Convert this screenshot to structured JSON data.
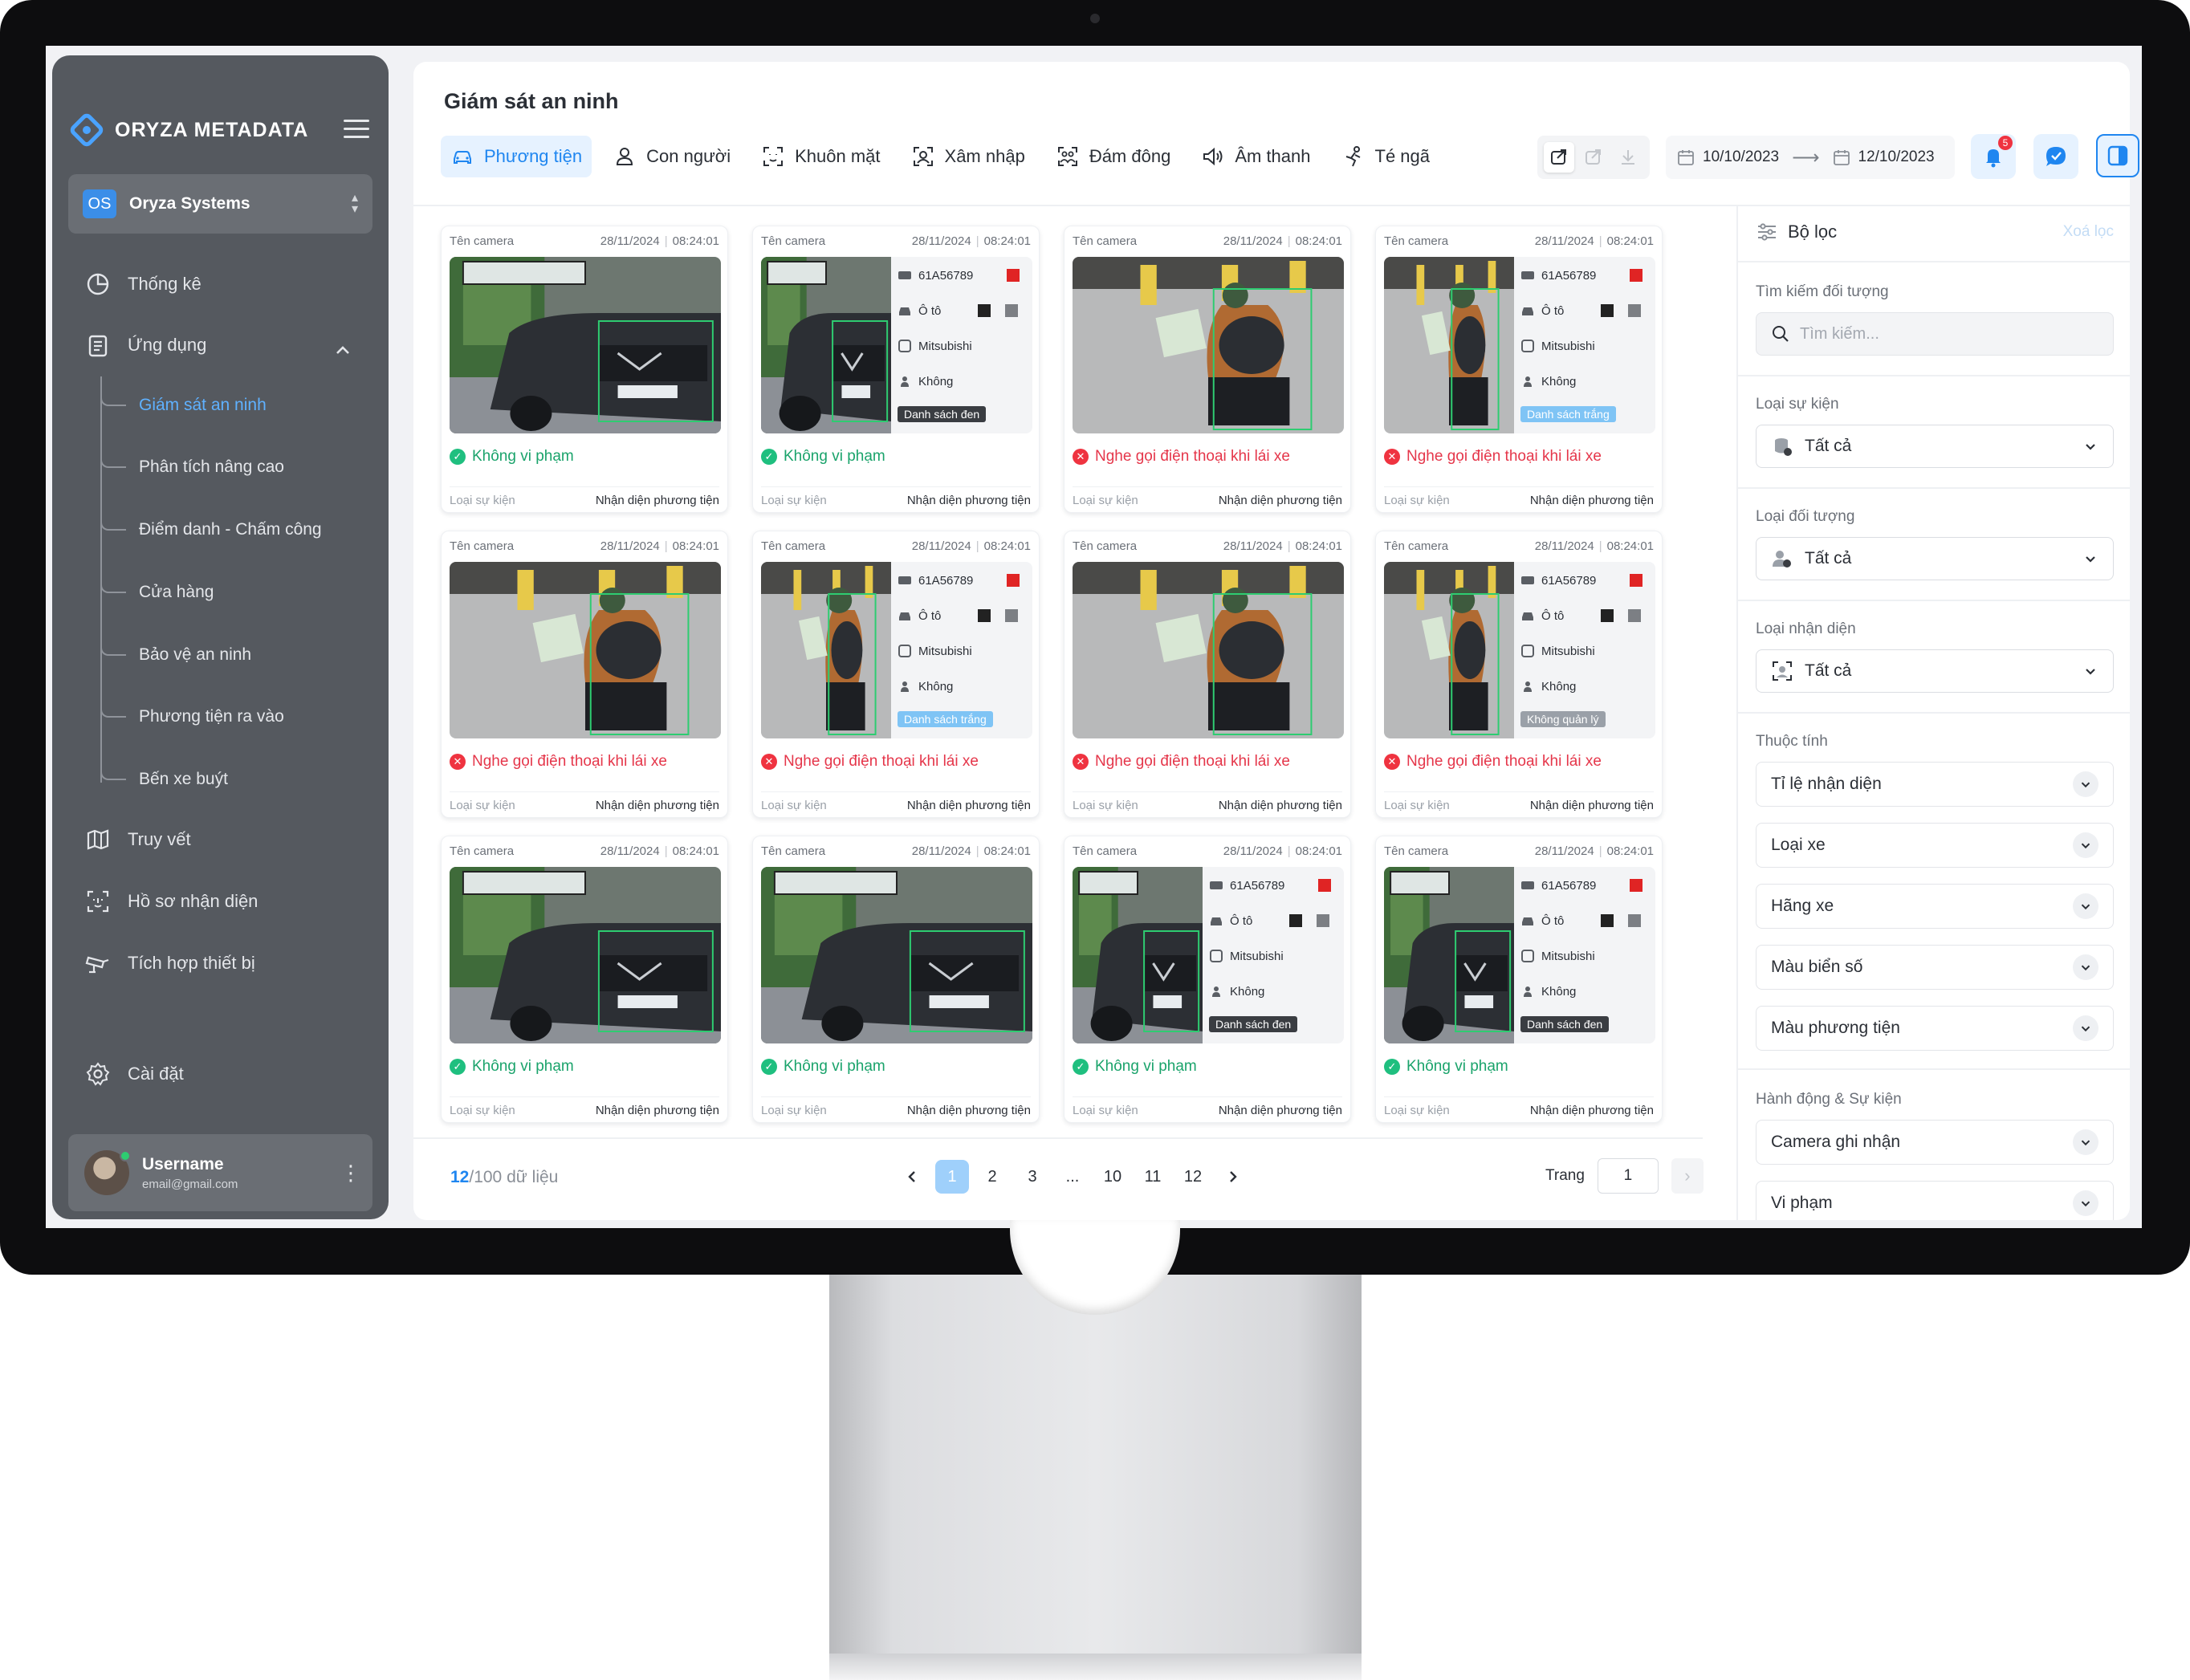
{
  "brand": {
    "name": "ORYZA METADATA"
  },
  "org": {
    "badge": "OS",
    "name": "Oryza Systems"
  },
  "nav": {
    "thong_ke": "Thống kê",
    "ung_dung": "Ứng dụng",
    "sub": [
      "Giám sát an ninh",
      "Phân tích nâng cao",
      "Điểm danh - Chấm công",
      "Cửa hàng",
      "Bảo vệ an ninh",
      "Phương tiện ra vào",
      "Bến xe buýt"
    ],
    "truy_vet": "Truy vết",
    "ho_so": "Hồ sơ nhận diện",
    "tich_hop": "Tích hợp thiết bị",
    "cai_dat": "Cài đặt"
  },
  "user": {
    "name": "Username",
    "email": "email@gmail.com"
  },
  "page": {
    "title": "Giám sát an ninh"
  },
  "tabs": [
    "Phương tiện",
    "Con người",
    "Khuôn mặt",
    "Xâm nhập",
    "Đám đông",
    "Âm thanh",
    "Té ngã"
  ],
  "date_range": {
    "from": "10/10/2023",
    "to": "12/10/2023"
  },
  "notifications": {
    "count": "5"
  },
  "card_common": {
    "camera": "Tên camera",
    "date": "28/11/2024",
    "time": "08:24:01",
    "event_label": "Loại sự kiện",
    "event_value": "Nhận diện phương tiện",
    "plate": "61A56789",
    "vehicle": "Ô tô",
    "brand": "Mitsubishi",
    "none": "Không"
  },
  "cards": [
    {
      "layout": "car",
      "status": "ok",
      "status_text": "Không vi phạm",
      "tag": ""
    },
    {
      "layout": "car-info",
      "status": "ok",
      "status_text": "Không vi phạm",
      "tag": "Danh sách đen",
      "tag_style": "dark"
    },
    {
      "layout": "moto",
      "status": "bad",
      "status_text": "Nghe gọi điện thoại khi lái xe",
      "tag": ""
    },
    {
      "layout": "moto-info",
      "status": "bad",
      "status_text": "Nghe gọi điện thoại khi lái xe",
      "tag": "Danh sách trắng",
      "tag_style": "light"
    },
    {
      "layout": "moto",
      "status": "bad",
      "status_text": "Nghe gọi điện thoại khi lái xe",
      "tag": ""
    },
    {
      "layout": "moto-info",
      "status": "bad",
      "status_text": "Nghe gọi điện thoại khi lái xe",
      "tag": "Danh sách trắng",
      "tag_style": "light"
    },
    {
      "layout": "moto",
      "status": "bad",
      "status_text": "Nghe gọi điện thoại khi lái xe",
      "tag": ""
    },
    {
      "layout": "moto-info",
      "status": "bad",
      "status_text": "Nghe gọi điện thoại khi lái xe",
      "tag": "Không quản lý",
      "tag_style": "grey"
    },
    {
      "layout": "car",
      "status": "ok",
      "status_text": "Không vi phạm",
      "tag": ""
    },
    {
      "layout": "car",
      "status": "ok",
      "status_text": "Không vi phạm",
      "tag": ""
    },
    {
      "layout": "car-info",
      "status": "ok",
      "status_text": "Không vi phạm",
      "tag": "Danh sách đen",
      "tag_style": "dark"
    },
    {
      "layout": "car-info",
      "status": "ok",
      "status_text": "Không vi phạm",
      "tag": "Danh sách đen",
      "tag_style": "dark"
    }
  ],
  "pagination": {
    "shown": "12",
    "total": "/100",
    "suffix": "dữ liệu",
    "pages": [
      "1",
      "2",
      "3",
      "...",
      "10",
      "11",
      "12"
    ],
    "goto_label": "Trang",
    "goto_value": "1"
  },
  "filter": {
    "title": "Bộ lọc",
    "clear": "Xoá lọc",
    "search_label": "Tìm kiếm đối tượng",
    "search_placeholder": "Tìm kiếm...",
    "event_type_label": "Loại sự kiện",
    "event_type_value": "Tất cả",
    "object_type_label": "Loại đối tượng",
    "object_type_value": "Tất cả",
    "recog_type_label": "Loại nhận diện",
    "recog_type_value": "Tất cả",
    "attributes_label": "Thuộc tính",
    "attributes": [
      "Tỉ lệ nhận diện",
      "Loại xe",
      "Hãng xe",
      "Màu biển số",
      "Màu phương tiện"
    ],
    "actions_label": "Hành động & Sự kiện",
    "actions": [
      "Camera ghi nhận",
      "Vi phạm"
    ]
  },
  "colors": {
    "accent": "#1f86f0",
    "sidebar_bg": "#55595f",
    "ok": "#1aa36b",
    "bad": "#e5364a"
  }
}
